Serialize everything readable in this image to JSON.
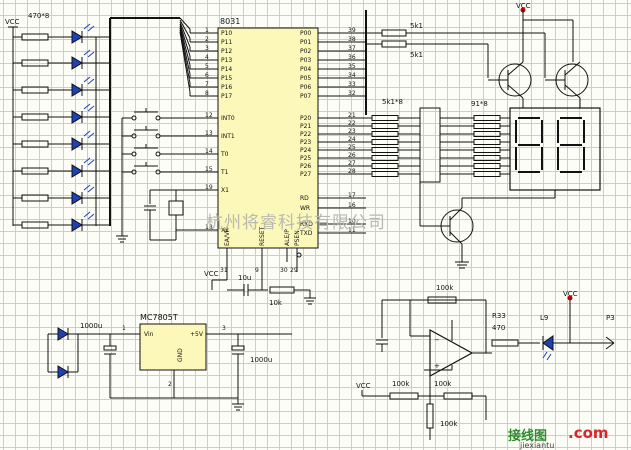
{
  "labels": {
    "vcc": "VCC",
    "led_array": "470*8",
    "mcu": "8031",
    "p0_pack": "5k1",
    "p0_pack2": "5k1",
    "p2_pack": "5k1*8",
    "seg_pack": "91*8",
    "cap_10u": "10u",
    "res_10k": "10k",
    "reg": "MC7805T",
    "reg_vin": "Vin",
    "reg_gnd": "GND",
    "reg_out": "+5V",
    "cap_in": "1000u",
    "cap_out": "1000u",
    "fb_res": "100k",
    "in_res": "100k",
    "bias_res": "100k",
    "out_res_name": "R33",
    "out_res_val": "470",
    "diode": "L9",
    "connector": "P3",
    "watermark": "杭州将睿科技有限公司",
    "logo_cn": "接线图",
    "logo_com": ".com",
    "logo_url": "jiexiantu"
  },
  "pins_left": [
    "P10",
    "P11",
    "P12",
    "P13",
    "P14",
    "P15",
    "P16",
    "P17",
    "INT0",
    "INT1",
    "T0",
    "T1",
    "X1",
    "X2"
  ],
  "pins_left_num": [
    "1",
    "2",
    "3",
    "4",
    "5",
    "6",
    "7",
    "8",
    "12",
    "13",
    "14",
    "15",
    "19",
    "18"
  ],
  "pins_right_p0": [
    "P00",
    "P01",
    "P02",
    "P03",
    "P04",
    "P05",
    "P06",
    "P07"
  ],
  "pins_right_p0_num": [
    "39",
    "38",
    "37",
    "36",
    "35",
    "34",
    "33",
    "32"
  ],
  "pins_right_p2": [
    "P20",
    "P21",
    "P22",
    "P23",
    "P24",
    "P25",
    "P26",
    "P27"
  ],
  "pins_right_p2_num": [
    "21",
    "22",
    "23",
    "24",
    "25",
    "26",
    "27",
    "28"
  ],
  "pins_right_misc": [
    "RD",
    "WR",
    "RXD",
    "TXD"
  ],
  "pins_right_misc_num": [
    "17",
    "16",
    "10",
    "11"
  ],
  "pins_bottom": [
    "EA/VP",
    "RESET",
    "ALE/P",
    "PSEN"
  ],
  "pins_bottom_num": [
    "31",
    "9",
    "30",
    "29"
  ],
  "reg_pins": [
    "1",
    "3",
    "2"
  ]
}
